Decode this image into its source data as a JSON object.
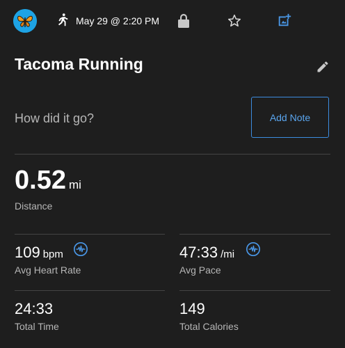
{
  "header": {
    "date": "May 29 @ 2:20 PM",
    "icons": [
      "butterfly-avatar",
      "running-icon",
      "lock-icon",
      "star-icon",
      "add-photo-icon"
    ]
  },
  "activity": {
    "title": "Tacoma Running"
  },
  "note": {
    "prompt": "How did it go?",
    "button_label": "Add Note"
  },
  "stats": {
    "distance": {
      "value": "0.52",
      "unit": "mi",
      "label": "Distance"
    },
    "heart_rate": {
      "value": "109",
      "unit": "bpm",
      "label": "Avg Heart Rate"
    },
    "pace": {
      "value": "47:33",
      "unit": "/mi",
      "label": "Avg Pace"
    },
    "time": {
      "value": "24:33",
      "label": "Total Time"
    },
    "calories": {
      "value": "149",
      "label": "Total Calories"
    }
  },
  "colors": {
    "background": "#1e1e1e",
    "accent": "#3d8de0",
    "avatar": "#1ea3e4"
  }
}
